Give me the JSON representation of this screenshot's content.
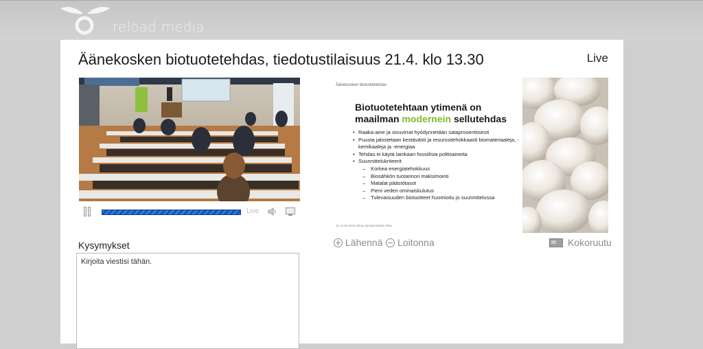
{
  "header": {
    "brand": "reload media",
    "logo_icon": "leaf-ring-logo-icon"
  },
  "event": {
    "title": "Äänekosken biotuotetehdas, tiedotustilaisuus 21.4. klo 13.30",
    "status": "Live"
  },
  "player": {
    "live_label": "Live",
    "icons": [
      "pause-icon",
      "volume-icon",
      "fullscreen-icon"
    ],
    "progress_color": "#1b63c6"
  },
  "slide": {
    "header": "Äänekosken biotuotetehdas",
    "title_line1": "Biotuotetehtaan ytimenä on",
    "title_line2_prefix": "maailman ",
    "title_accent": "modernein",
    "title_line2_suffix": " sellutehdas",
    "accent_color": "#7dbb2b",
    "bullets": [
      "Raaka-aine ja sivuvirrat hyödynnetään sataprosenttisesti",
      "Puusta jalostetaan kestävästi ja resurssitehokkaasti biomateriaaleja, -kemikaaleja ja -energiaa",
      "Tehdas ei käytä lainkaan fossiilisia polttoaineita",
      "Suunnittelukriteerit"
    ],
    "sub_bullets": [
      "Korkea energiatehokkuus",
      "Biosähkön tuotannon maksimointi",
      "Matalat päästötasot",
      "Pieni veden ominaiskulutus",
      "Tulevaisuuden biotuotteet huomioitu jo suunnittelussa"
    ],
    "footer": "21 21.04.2015 Niina Hamala Metsä Fibre"
  },
  "slide_controls": {
    "zoom_in": "Lähennä",
    "zoom_out": "Loitonna",
    "fullscreen": "Kokoruutu"
  },
  "questions": {
    "label": "Kysymykset",
    "placeholder": "Kirjoita viestisi tähän."
  }
}
